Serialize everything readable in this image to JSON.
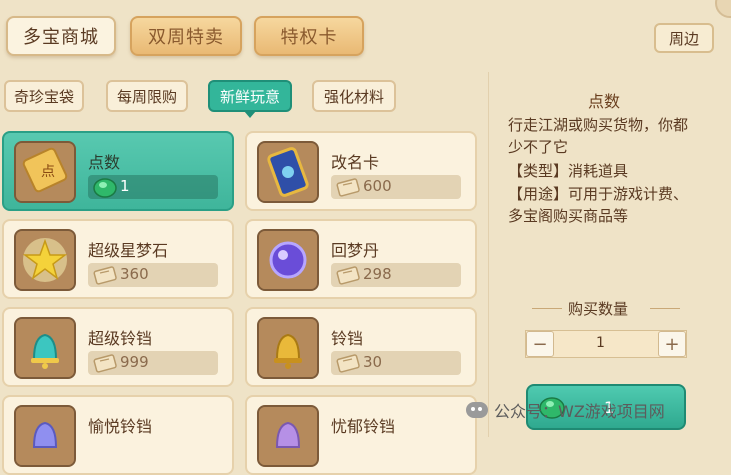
{
  "top_tabs": [
    {
      "label": "多宝商城",
      "active": true
    },
    {
      "label": "双周特卖",
      "active": false
    },
    {
      "label": "特权卡",
      "active": false
    }
  ],
  "nearby_label": "周边",
  "sub_tabs": [
    {
      "label": "奇珍宝袋",
      "active": false
    },
    {
      "label": "每周限购",
      "active": false
    },
    {
      "label": "新鲜玩意",
      "active": true
    },
    {
      "label": "强化材料",
      "active": false
    }
  ],
  "items": [
    {
      "name": "点数",
      "price": "1",
      "currency": "jade-icon",
      "icon": "points-token-icon",
      "selected": true
    },
    {
      "name": "改名卡",
      "price": "600",
      "currency": "ticket-icon",
      "icon": "rename-card-icon",
      "selected": false
    },
    {
      "name": "超级星梦石",
      "price": "360",
      "currency": "ticket-icon",
      "icon": "star-dream-stone-icon",
      "selected": false
    },
    {
      "name": "回梦丹",
      "price": "298",
      "currency": "ticket-icon",
      "icon": "dream-pill-icon",
      "selected": false
    },
    {
      "name": "超级铃铛",
      "price": "999",
      "currency": "ticket-icon",
      "icon": "super-bell-icon",
      "selected": false
    },
    {
      "name": "铃铛",
      "price": "30",
      "currency": "ticket-icon",
      "icon": "bell-icon",
      "selected": false
    },
    {
      "name": "愉悦铃铛",
      "price": "",
      "currency": "ticket-icon",
      "icon": "joy-bell-icon",
      "selected": false
    },
    {
      "name": "忧郁铃铛",
      "price": "",
      "currency": "ticket-icon",
      "icon": "gloom-bell-icon",
      "selected": false
    }
  ],
  "detail": {
    "title": "点数",
    "lines": [
      "行走江湖或购买货物，你都",
      "少不了它",
      "【类型】消耗道具",
      "【用途】可用于游戏计费、",
      "多宝阁购买商品等"
    ]
  },
  "quantity": {
    "title": "购买数量",
    "value": "1",
    "minus": "−",
    "plus": "+"
  },
  "buy_button": {
    "label": "1"
  },
  "watermark": "公众号：WZ游戏项目网",
  "colors": {
    "background": "#efe3c7",
    "accent_teal": "#33b69a",
    "card": "#fbf2de",
    "text_brown": "#5a3a22"
  }
}
